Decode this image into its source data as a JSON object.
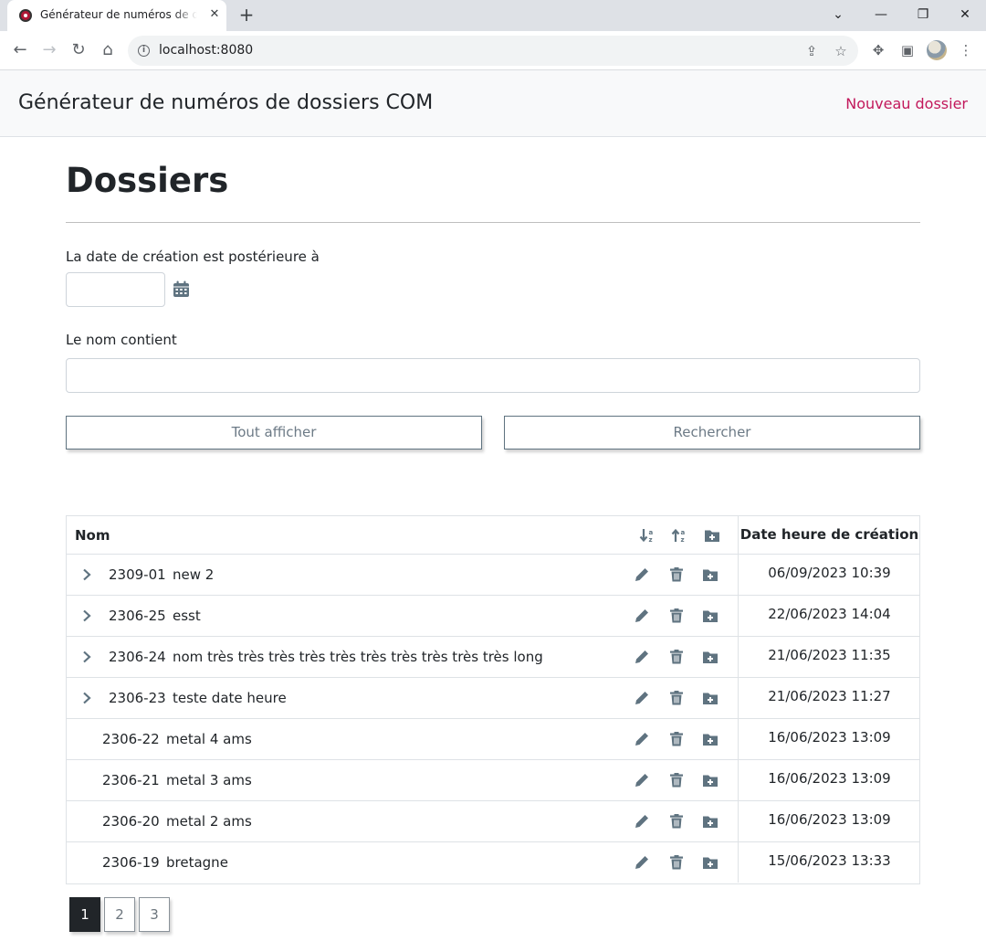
{
  "browser": {
    "tab_title": "Générateur de numéros de dossiers COM",
    "tab_close": "✕",
    "new_tab": "+",
    "url": "localhost:8080"
  },
  "appbar": {
    "brand": "Générateur de numéros de dossiers COM",
    "new_folder_link": "Nouveau dossier"
  },
  "page": {
    "title": "Dossiers"
  },
  "filters": {
    "date_label": "La date de création est postérieure à",
    "date_value": "",
    "name_label": "Le nom contient",
    "name_value": "",
    "show_all_button": "Tout afficher",
    "search_button": "Rechercher"
  },
  "table": {
    "headers": {
      "name": "Nom",
      "created": "Date heure de création"
    },
    "rows": [
      {
        "number": "2309-01",
        "name": "new 2",
        "created": "06/09/2023 10:39",
        "expandable": true
      },
      {
        "number": "2306-25",
        "name": "esst",
        "created": "22/06/2023 14:04",
        "expandable": true
      },
      {
        "number": "2306-24",
        "name": "nom très très très très très très très très très très long",
        "created": "21/06/2023 11:35",
        "expandable": true
      },
      {
        "number": "2306-23",
        "name": "teste date heure",
        "created": "21/06/2023 11:27",
        "expandable": true
      },
      {
        "number": "2306-22",
        "name": "metal 4 ams",
        "created": "16/06/2023 13:09",
        "expandable": false
      },
      {
        "number": "2306-21",
        "name": "metal 3 ams",
        "created": "16/06/2023 13:09",
        "expandable": false
      },
      {
        "number": "2306-20",
        "name": "metal 2 ams",
        "created": "16/06/2023 13:09",
        "expandable": false
      },
      {
        "number": "2306-19",
        "name": "bretagne",
        "created": "15/06/2023 13:33",
        "expandable": false
      }
    ]
  },
  "pagination": {
    "pages": [
      "1",
      "2",
      "3"
    ],
    "current": "1"
  },
  "colors": {
    "icon": "#5f7380",
    "link": "#c2185b",
    "active_page": "#212529"
  }
}
